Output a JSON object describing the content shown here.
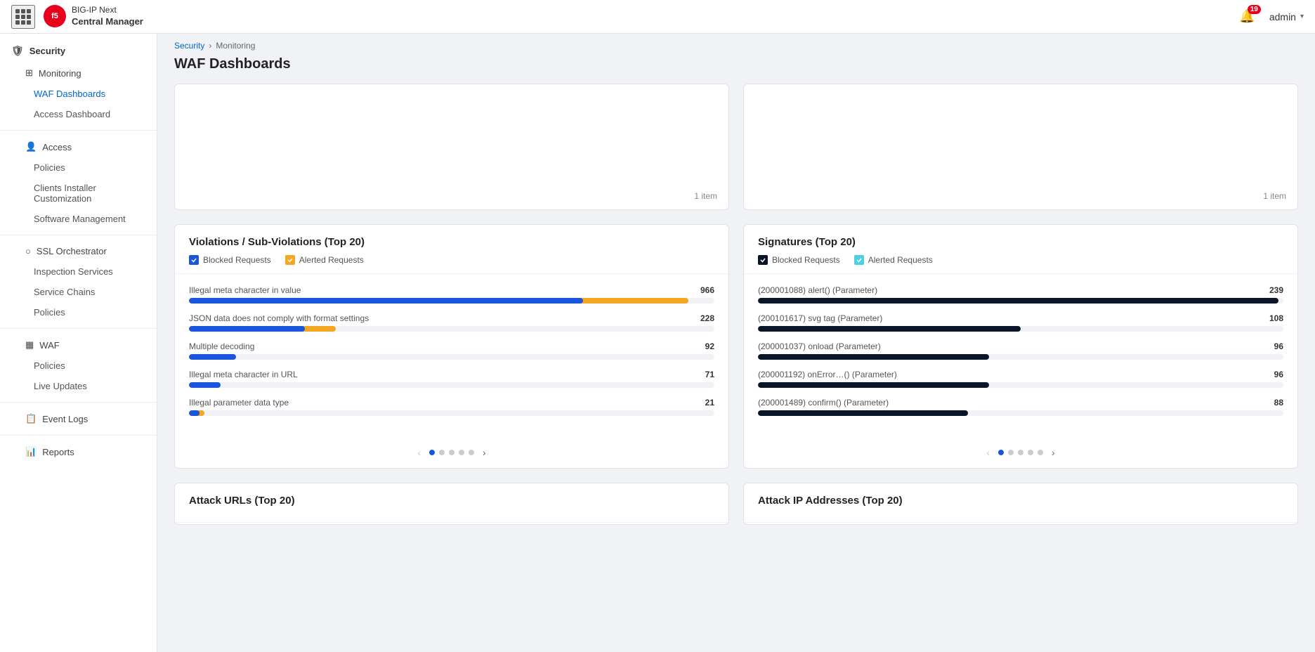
{
  "app": {
    "logo_initials": "f5",
    "app_line1": "BIG-IP Next",
    "app_line2": "Central Manager"
  },
  "topbar": {
    "notification_count": "19",
    "user_name": "admin"
  },
  "breadcrumb": {
    "items": [
      "Security",
      "Monitoring"
    ],
    "separator": "›"
  },
  "page_title": "WAF Dashboards",
  "sidebar": {
    "sections": [
      {
        "id": "security",
        "label": "Security",
        "icon": "shield"
      }
    ],
    "monitoring_label": "Monitoring",
    "waf_dashboards_label": "WAF Dashboards",
    "access_dashboard_label": "Access Dashboard",
    "access_label": "Access",
    "policies_label_1": "Policies",
    "clients_label": "Clients Installer Customization",
    "software_label": "Software Management",
    "ssl_label": "SSL Orchestrator",
    "inspection_label": "Inspection Services",
    "service_chains_label": "Service Chains",
    "policies_label_2": "Policies",
    "waf_label": "WAF",
    "policies_label_3": "Policies",
    "live_updates_label": "Live Updates",
    "event_logs_label": "Event Logs",
    "reports_label": "Reports"
  },
  "top_panels": {
    "left_item_count": "1 item",
    "right_item_count": "1 item"
  },
  "violations_panel": {
    "title": "Violations / Sub-Violations (Top 20)",
    "legends": [
      {
        "id": "blocked",
        "label": "Blocked Requests",
        "color": "blue"
      },
      {
        "id": "alerted",
        "label": "Alerted Requests",
        "color": "yellow"
      }
    ],
    "items": [
      {
        "label": "Illegal meta character in value",
        "value": 966,
        "max": 966,
        "blocked_pct": 75,
        "alerted_pct": 95
      },
      {
        "label": "JSON data does not comply with format settings",
        "value": 228,
        "max": 966,
        "blocked_pct": 22,
        "alerted_pct": 28
      },
      {
        "label": "Multiple decoding",
        "value": 92,
        "max": 966,
        "blocked_pct": 9,
        "alerted_pct": 0
      },
      {
        "label": "Illegal meta character in URL",
        "value": 71,
        "max": 966,
        "blocked_pct": 6,
        "alerted_pct": 0
      },
      {
        "label": "Illegal parameter data type",
        "value": 21,
        "max": 966,
        "blocked_pct": 2,
        "alerted_pct": 3
      }
    ],
    "pagination": {
      "total": 5,
      "active": 0
    }
  },
  "signatures_panel": {
    "title": "Signatures (Top 20)",
    "legends": [
      {
        "id": "blocked",
        "label": "Blocked Requests",
        "color": "dark"
      },
      {
        "id": "alerted",
        "label": "Alerted Requests",
        "color": "teal"
      }
    ],
    "items": [
      {
        "label": "(200001088) alert() (Parameter)",
        "value": 239,
        "max": 239,
        "blocked_pct": 99,
        "alerted_pct": 0
      },
      {
        "label": "(200101617) svg tag (Parameter)",
        "value": 108,
        "max": 239,
        "blocked_pct": 50,
        "alerted_pct": 0
      },
      {
        "label": "(200001037) onload (Parameter)",
        "value": 96,
        "max": 239,
        "blocked_pct": 44,
        "alerted_pct": 0
      },
      {
        "label": "(200001192) onError…() (Parameter)",
        "value": 96,
        "max": 239,
        "blocked_pct": 44,
        "alerted_pct": 0
      },
      {
        "label": "(200001489) confirm() (Parameter)",
        "value": 88,
        "max": 239,
        "blocked_pct": 40,
        "alerted_pct": 5
      }
    ],
    "pagination": {
      "total": 5,
      "active": 0
    }
  },
  "bottom_panels": {
    "left_title": "Attack URLs (Top 20)",
    "right_title": "Attack IP Addresses (Top 20)"
  }
}
